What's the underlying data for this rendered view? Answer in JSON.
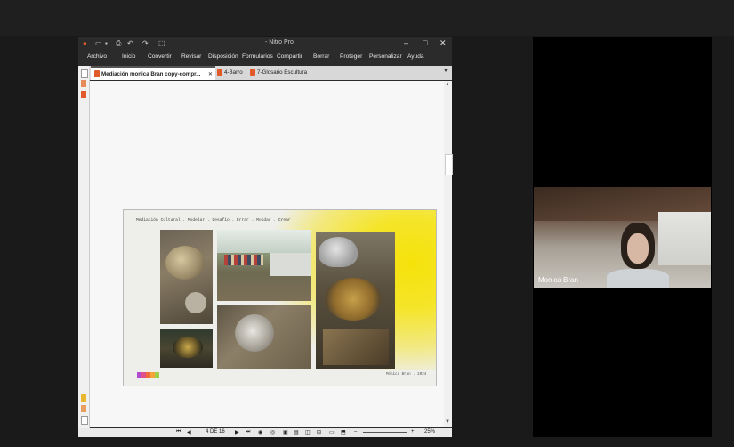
{
  "app": {
    "title": "- Nitro Pro"
  },
  "ribbon": {
    "tabs": [
      "Archivo",
      "Inicio",
      "Convertir",
      "Revisar",
      "Disposición",
      "Formularios",
      "Compartir",
      "Borrar",
      "Proteger",
      "Personalizar",
      "Ayuda"
    ]
  },
  "documents": {
    "tabs": [
      {
        "label": "Mediación monica Bran copy-compr...",
        "active": true
      },
      {
        "label": "4-Barro",
        "active": false
      },
      {
        "label": "7-Glosario Escultura",
        "active": false
      }
    ]
  },
  "page": {
    "header": "Mediación Cultural . Modelar . Desafío . Errar . Moldar . Crear",
    "footer": "Mónica Bran . 2024",
    "palette": [
      "#b04ccf",
      "#e0508a",
      "#f06a3a",
      "#f4a53a",
      "#9fcf4a"
    ]
  },
  "status": {
    "page_indicator": "4 DE 16",
    "zoom": "25%"
  },
  "video": {
    "participant_name": "Monica Bran"
  },
  "colors": {
    "accent": "#f5e20a",
    "dark_bg": "#1a1a1a"
  }
}
